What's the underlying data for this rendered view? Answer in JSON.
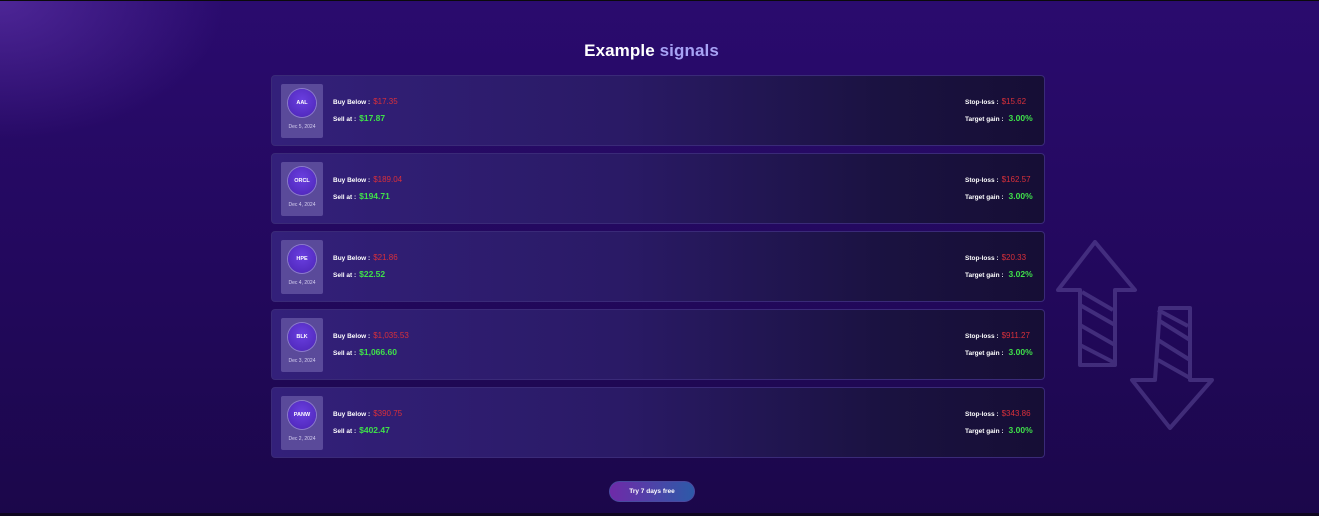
{
  "title": {
    "part1": "Example",
    "part2": "signals"
  },
  "signals": [
    {
      "ticker": "AAL",
      "date": "Dec 5, 2024",
      "buy_label": "Buy Below :",
      "buy_value": "$17.35",
      "sell_label": "Sell at :",
      "sell_value": "$17.87",
      "stop_label": "Stop-loss :",
      "stop_value": "$15.62",
      "gain_label": "Target gain :",
      "gain_value": "3.00%"
    },
    {
      "ticker": "ORCL",
      "date": "Dec 4, 2024",
      "buy_label": "Buy Below :",
      "buy_value": "$189.04",
      "sell_label": "Sell at :",
      "sell_value": "$194.71",
      "stop_label": "Stop-loss :",
      "stop_value": "$162.57",
      "gain_label": "Target gain :",
      "gain_value": "3.00%"
    },
    {
      "ticker": "HPE",
      "date": "Dec 4, 2024",
      "buy_label": "Buy Below :",
      "buy_value": "$21.86",
      "sell_label": "Sell at :",
      "sell_value": "$22.52",
      "stop_label": "Stop-loss :",
      "stop_value": "$20.33",
      "gain_label": "Target gain :",
      "gain_value": "3.02%"
    },
    {
      "ticker": "BLK",
      "date": "Dec 3, 2024",
      "buy_label": "Buy Below :",
      "buy_value": "$1,035.53",
      "sell_label": "Sell at :",
      "sell_value": "$1,066.60",
      "stop_label": "Stop-loss :",
      "stop_value": "$911.27",
      "gain_label": "Target gain :",
      "gain_value": "3.00%"
    },
    {
      "ticker": "PANW",
      "date": "Dec 2, 2024",
      "buy_label": "Buy Below :",
      "buy_value": "$390.75",
      "sell_label": "Sell at :",
      "sell_value": "$402.47",
      "stop_label": "Stop-loss :",
      "stop_value": "$343.86",
      "gain_label": "Target gain :",
      "gain_value": "3.00%"
    }
  ],
  "cta": {
    "label": "Try 7 days free"
  },
  "icons": {
    "decoration": "up-down-arrows-icon"
  },
  "colors": {
    "loss": "#d9303a",
    "gain": "#3fe04a",
    "accent": "#a7a2f5"
  }
}
